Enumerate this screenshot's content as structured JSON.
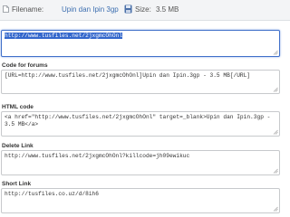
{
  "top": {
    "filename_label": "Filename:",
    "filename_value": "Upin dan Ipin 3gp",
    "size_label": "Size:",
    "size_value": "3.5 MB"
  },
  "icons": {
    "file": "file-icon",
    "save": "save-disk-icon",
    "resize": "resize-grip-icon"
  },
  "colors": {
    "selection": "#3367cc",
    "focus_border": "#3f6fc9",
    "link": "#3d6fb0"
  },
  "fields": [
    {
      "id": "link",
      "label": "",
      "value": "http://www.tusfiles.net/2jxgmcOhOnl"
    },
    {
      "id": "forums",
      "label": "Code for forums",
      "value": "[URL=http://www.tusfiles.net/2jxgmcOhOnl]Upin dan Ipin.3gp - 3.5 MB[/URL]"
    },
    {
      "id": "html",
      "label": "HTML code",
      "value": "<a href=\"http://www.tusfiles.net/2jxgmcOhOnl\" target=_blank>Upin dan Ipin.3gp - 3.5 MB</a>"
    },
    {
      "id": "delete",
      "label": "Delete Link",
      "value": "http://www.tusfiles.net/2jxgmcOhOnl?killcode=jh09ewikuc"
    },
    {
      "id": "short",
      "label": "Short Link",
      "value": "http://tusfiles.co.uz/d/8ih6"
    }
  ]
}
